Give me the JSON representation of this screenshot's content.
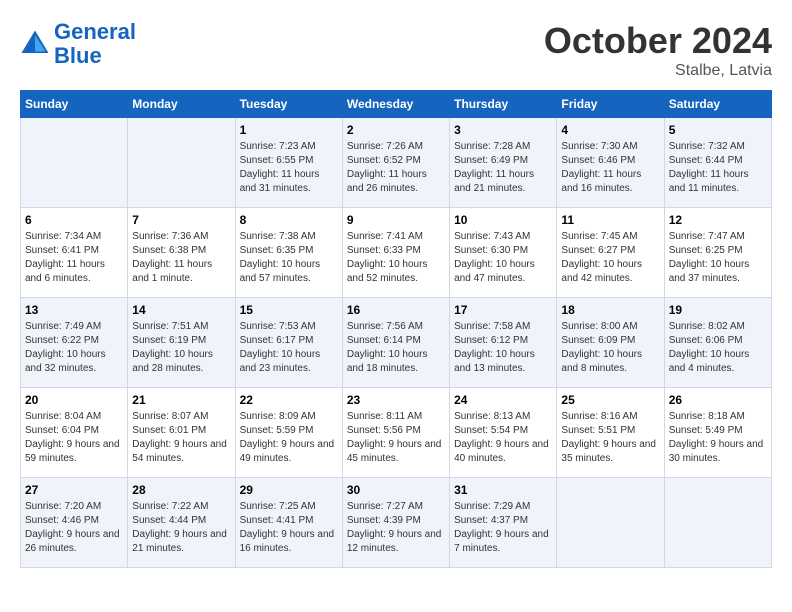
{
  "header": {
    "logo_line1": "General",
    "logo_line2": "Blue",
    "month": "October 2024",
    "location": "Stalbe, Latvia"
  },
  "days_of_week": [
    "Sunday",
    "Monday",
    "Tuesday",
    "Wednesday",
    "Thursday",
    "Friday",
    "Saturday"
  ],
  "weeks": [
    [
      {
        "day": "",
        "info": ""
      },
      {
        "day": "",
        "info": ""
      },
      {
        "day": "1",
        "info": "Sunrise: 7:23 AM\nSunset: 6:55 PM\nDaylight: 11 hours and 31 minutes."
      },
      {
        "day": "2",
        "info": "Sunrise: 7:26 AM\nSunset: 6:52 PM\nDaylight: 11 hours and 26 minutes."
      },
      {
        "day": "3",
        "info": "Sunrise: 7:28 AM\nSunset: 6:49 PM\nDaylight: 11 hours and 21 minutes."
      },
      {
        "day": "4",
        "info": "Sunrise: 7:30 AM\nSunset: 6:46 PM\nDaylight: 11 hours and 16 minutes."
      },
      {
        "day": "5",
        "info": "Sunrise: 7:32 AM\nSunset: 6:44 PM\nDaylight: 11 hours and 11 minutes."
      }
    ],
    [
      {
        "day": "6",
        "info": "Sunrise: 7:34 AM\nSunset: 6:41 PM\nDaylight: 11 hours and 6 minutes."
      },
      {
        "day": "7",
        "info": "Sunrise: 7:36 AM\nSunset: 6:38 PM\nDaylight: 11 hours and 1 minute."
      },
      {
        "day": "8",
        "info": "Sunrise: 7:38 AM\nSunset: 6:35 PM\nDaylight: 10 hours and 57 minutes."
      },
      {
        "day": "9",
        "info": "Sunrise: 7:41 AM\nSunset: 6:33 PM\nDaylight: 10 hours and 52 minutes."
      },
      {
        "day": "10",
        "info": "Sunrise: 7:43 AM\nSunset: 6:30 PM\nDaylight: 10 hours and 47 minutes."
      },
      {
        "day": "11",
        "info": "Sunrise: 7:45 AM\nSunset: 6:27 PM\nDaylight: 10 hours and 42 minutes."
      },
      {
        "day": "12",
        "info": "Sunrise: 7:47 AM\nSunset: 6:25 PM\nDaylight: 10 hours and 37 minutes."
      }
    ],
    [
      {
        "day": "13",
        "info": "Sunrise: 7:49 AM\nSunset: 6:22 PM\nDaylight: 10 hours and 32 minutes."
      },
      {
        "day": "14",
        "info": "Sunrise: 7:51 AM\nSunset: 6:19 PM\nDaylight: 10 hours and 28 minutes."
      },
      {
        "day": "15",
        "info": "Sunrise: 7:53 AM\nSunset: 6:17 PM\nDaylight: 10 hours and 23 minutes."
      },
      {
        "day": "16",
        "info": "Sunrise: 7:56 AM\nSunset: 6:14 PM\nDaylight: 10 hours and 18 minutes."
      },
      {
        "day": "17",
        "info": "Sunrise: 7:58 AM\nSunset: 6:12 PM\nDaylight: 10 hours and 13 minutes."
      },
      {
        "day": "18",
        "info": "Sunrise: 8:00 AM\nSunset: 6:09 PM\nDaylight: 10 hours and 8 minutes."
      },
      {
        "day": "19",
        "info": "Sunrise: 8:02 AM\nSunset: 6:06 PM\nDaylight: 10 hours and 4 minutes."
      }
    ],
    [
      {
        "day": "20",
        "info": "Sunrise: 8:04 AM\nSunset: 6:04 PM\nDaylight: 9 hours and 59 minutes."
      },
      {
        "day": "21",
        "info": "Sunrise: 8:07 AM\nSunset: 6:01 PM\nDaylight: 9 hours and 54 minutes."
      },
      {
        "day": "22",
        "info": "Sunrise: 8:09 AM\nSunset: 5:59 PM\nDaylight: 9 hours and 49 minutes."
      },
      {
        "day": "23",
        "info": "Sunrise: 8:11 AM\nSunset: 5:56 PM\nDaylight: 9 hours and 45 minutes."
      },
      {
        "day": "24",
        "info": "Sunrise: 8:13 AM\nSunset: 5:54 PM\nDaylight: 9 hours and 40 minutes."
      },
      {
        "day": "25",
        "info": "Sunrise: 8:16 AM\nSunset: 5:51 PM\nDaylight: 9 hours and 35 minutes."
      },
      {
        "day": "26",
        "info": "Sunrise: 8:18 AM\nSunset: 5:49 PM\nDaylight: 9 hours and 30 minutes."
      }
    ],
    [
      {
        "day": "27",
        "info": "Sunrise: 7:20 AM\nSunset: 4:46 PM\nDaylight: 9 hours and 26 minutes."
      },
      {
        "day": "28",
        "info": "Sunrise: 7:22 AM\nSunset: 4:44 PM\nDaylight: 9 hours and 21 minutes."
      },
      {
        "day": "29",
        "info": "Sunrise: 7:25 AM\nSunset: 4:41 PM\nDaylight: 9 hours and 16 minutes."
      },
      {
        "day": "30",
        "info": "Sunrise: 7:27 AM\nSunset: 4:39 PM\nDaylight: 9 hours and 12 minutes."
      },
      {
        "day": "31",
        "info": "Sunrise: 7:29 AM\nSunset: 4:37 PM\nDaylight: 9 hours and 7 minutes."
      },
      {
        "day": "",
        "info": ""
      },
      {
        "day": "",
        "info": ""
      }
    ]
  ]
}
